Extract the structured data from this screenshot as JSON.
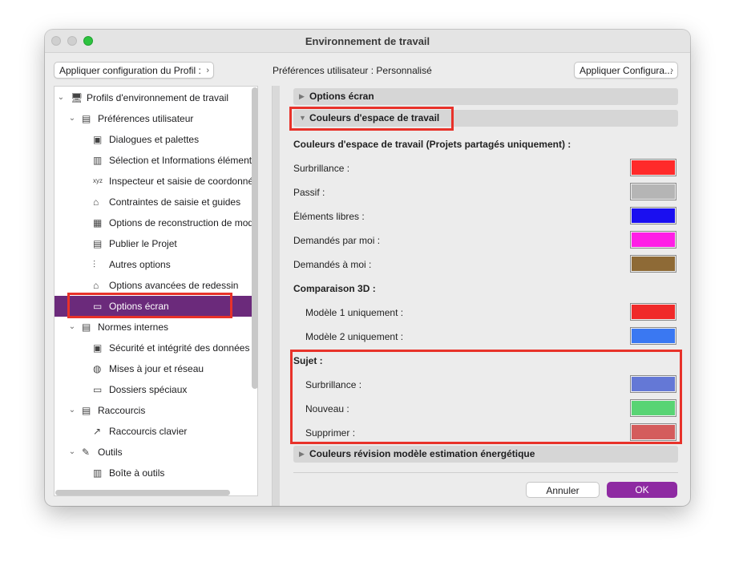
{
  "window": {
    "title": "Environnement de travail"
  },
  "toolbar": {
    "apply_profile_label": "Appliquer configuration du Profil :",
    "prefs_label": "Préférences utilisateur : Personnalisé",
    "apply_config_label": "Appliquer Configura..."
  },
  "tree": {
    "items": [
      {
        "label": "Profils d'environnement de travail",
        "level": 0,
        "expanded": true,
        "icon": "monitor-gear-icon"
      },
      {
        "label": "Préférences utilisateur",
        "level": 1,
        "expanded": true,
        "icon": "user-prefs-icon"
      },
      {
        "label": "Dialogues et palettes",
        "level": 2,
        "icon": "dialogs-icon"
      },
      {
        "label": "Sélection et Informations élément",
        "level": 2,
        "icon": "selection-icon"
      },
      {
        "label": "Inspecteur et saisie de coordonnées",
        "level": 2,
        "icon": "xyz-icon"
      },
      {
        "label": "Contraintes de saisie et guides",
        "level": 2,
        "icon": "mouse-icon"
      },
      {
        "label": "Options de reconstruction de modè",
        "level": 2,
        "icon": "blocks-icon"
      },
      {
        "label": "Publier le Projet",
        "level": 2,
        "icon": "publish-icon"
      },
      {
        "label": "Autres options",
        "level": 2,
        "icon": "sliders-icon"
      },
      {
        "label": "Options avancées de redessin",
        "level": 2,
        "icon": "redraw-icon"
      },
      {
        "label": "Options écran",
        "level": 2,
        "icon": "screen-icon",
        "selected": true
      },
      {
        "label": "Normes internes",
        "level": 1,
        "expanded": true,
        "icon": "standards-icon"
      },
      {
        "label": "Sécurité et intégrité des données",
        "level": 2,
        "icon": "security-icon"
      },
      {
        "label": "Mises à jour et réseau",
        "level": 2,
        "icon": "globe-icon"
      },
      {
        "label": "Dossiers spéciaux",
        "level": 2,
        "icon": "folder-icon"
      },
      {
        "label": "Raccourcis",
        "level": 1,
        "expanded": true,
        "icon": "shortcuts-icon"
      },
      {
        "label": "Raccourcis clavier",
        "level": 2,
        "icon": "keyboard-shortcut-icon"
      },
      {
        "label": "Outils",
        "level": 1,
        "expanded": true,
        "icon": "tools-icon"
      },
      {
        "label": "Boîte à outils",
        "level": 2,
        "icon": "toolbox-icon"
      }
    ]
  },
  "sections": {
    "screen_options": "Options écran",
    "workspace_colors": "Couleurs d'espace de travail",
    "energy_colors": "Couleurs révision modèle estimation énergétique"
  },
  "colors": {
    "header": "Couleurs d'espace de travail (Projets partagés uniquement) :",
    "rows": [
      {
        "label": "Surbrillance :",
        "color": "#ff2a2a"
      },
      {
        "label": "Passif :",
        "color": "#b5b5b5"
      },
      {
        "label": "Éléments libres :",
        "color": "#1a0ff0"
      },
      {
        "label": "Demandés par moi :",
        "color": "#ff1fe6"
      },
      {
        "label": "Demandés à moi :",
        "color": "#8e6a36"
      }
    ],
    "compare_header": "Comparaison 3D :",
    "compare_rows": [
      {
        "label": "Modèle 1 uniquement :",
        "color": "#f02a2a"
      },
      {
        "label": "Modèle 2 uniquement :",
        "color": "#3a78f2"
      }
    ],
    "subject_header": "Sujet :",
    "subject_rows": [
      {
        "label": "Surbrillance :",
        "color": "#6478d6"
      },
      {
        "label": "Nouveau :",
        "color": "#58d474"
      },
      {
        "label": "Supprimer :",
        "color": "#d45c5c"
      }
    ]
  },
  "buttons": {
    "cancel": "Annuler",
    "ok": "OK"
  },
  "accent_color": "#8e2aa2",
  "selection_color": "#6b2a7b",
  "highlight_box_color": "#e8322a"
}
